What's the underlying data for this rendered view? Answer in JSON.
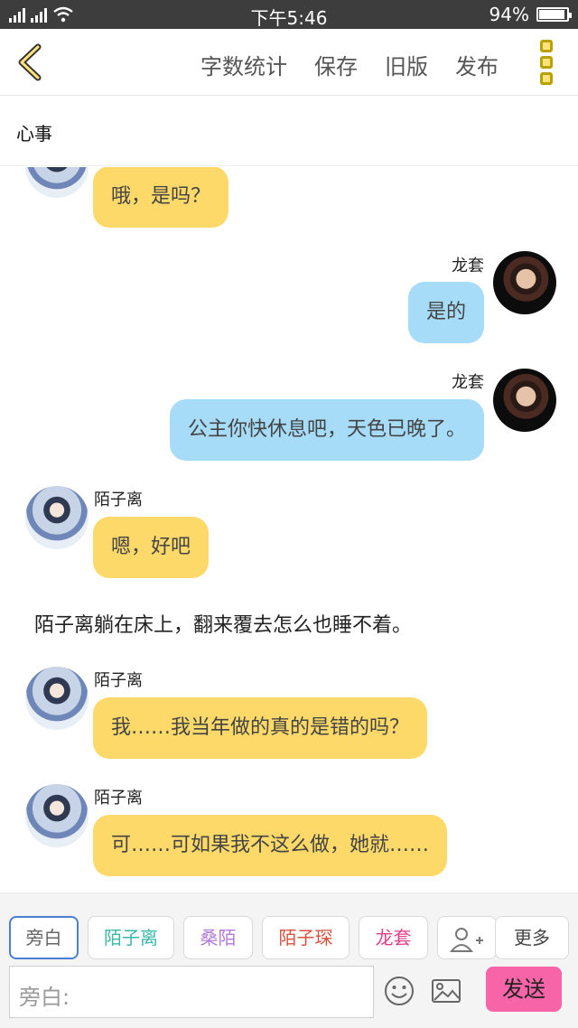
{
  "status_bar": {
    "time": "下午5:46",
    "battery": "94%",
    "network": "4G",
    "icons": [
      "signal-icon",
      "signal-icon",
      "wifi-icon",
      "battery-icon"
    ]
  },
  "toolbar": {
    "back_icon": "chevron-left-icon",
    "actions": [
      "字数统计",
      "保存",
      "旧版",
      "发布"
    ],
    "menu_icon": "more-vertical-icon"
  },
  "title": "心事",
  "messages": [
    {
      "type": "left",
      "name": "",
      "text": "哦，是吗？",
      "avatar": "avatar-girl",
      "bubble_color": "#fdd96a"
    },
    {
      "type": "right",
      "name": "龙套",
      "text": "是的",
      "avatar": "avatar-boy",
      "bubble_color": "#a6dcf7"
    },
    {
      "type": "right",
      "name": "龙套",
      "text": "公主你快休息吧，天色已晚了。",
      "avatar": "avatar-boy",
      "bubble_color": "#a6dcf7"
    },
    {
      "type": "left",
      "name": "陌子离",
      "text": "嗯，好吧",
      "avatar": "avatar-girl",
      "bubble_color": "#fdd96a"
    },
    {
      "type": "narration",
      "text": "陌子离躺在床上，翻来覆去怎么也睡不着。"
    },
    {
      "type": "left",
      "name": "陌子离",
      "text": "我……我当年做的真的是错的吗？",
      "avatar": "avatar-girl",
      "bubble_color": "#fdd96a"
    },
    {
      "type": "left",
      "name": "陌子离",
      "text": "可……可如果我不这么做，她就……",
      "avatar": "avatar-girl",
      "bubble_color": "#fdd96a"
    }
  ],
  "roles": [
    {
      "label": "旁白",
      "color": "#666666",
      "selected": true
    },
    {
      "label": "陌子离",
      "color": "#39b7a8",
      "selected": false
    },
    {
      "label": "桑陌",
      "color": "#b07ad6",
      "selected": false
    },
    {
      "label": "陌子琛",
      "color": "#d9503f",
      "selected": false
    },
    {
      "label": "龙套",
      "color": "#e0408a",
      "selected": false
    }
  ],
  "add_role_icon": "add-user-icon",
  "more_label": "更多",
  "input": {
    "placeholder": "旁白:"
  },
  "emoji_icon": "smiley-icon",
  "image_icon": "image-icon",
  "send_label": "发送",
  "colors": {
    "accent": "#f764a8",
    "bubble_left": "#fdd96a",
    "bubble_right": "#a6dcf7",
    "selected_border": "#4a7fd1"
  }
}
